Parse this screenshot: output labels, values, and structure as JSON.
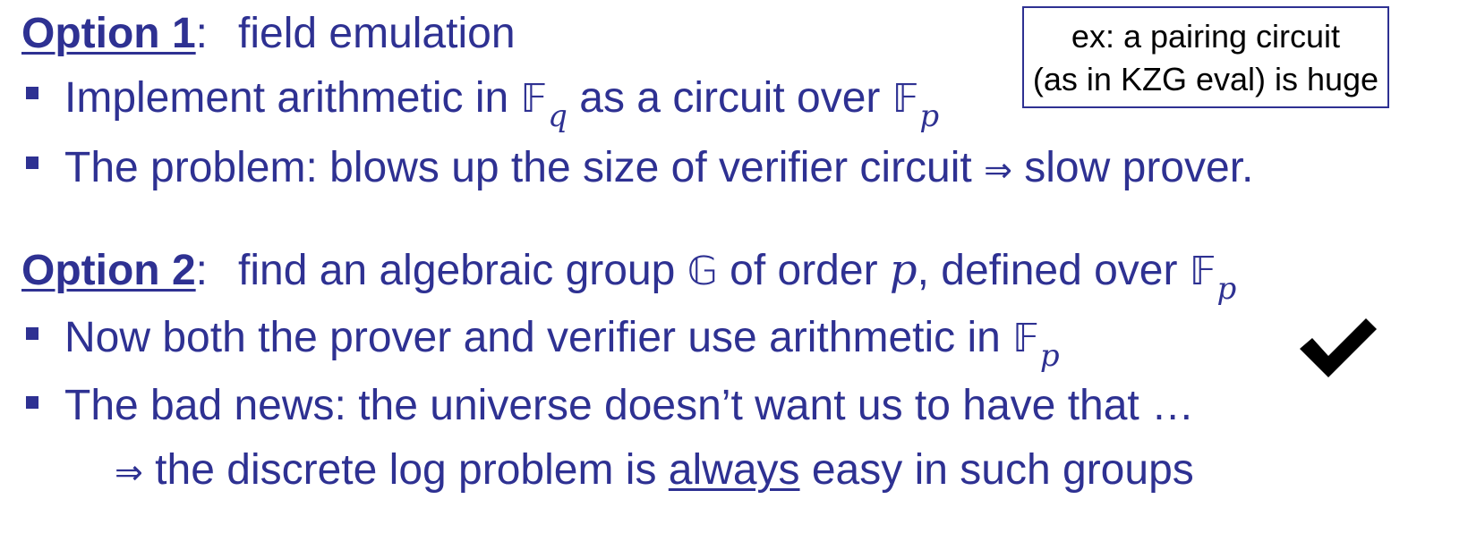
{
  "option1": {
    "label": "Option 1",
    "colon": ":",
    "title": "field emulation",
    "bullet1": {
      "text_before": "Implement arithmetic in ",
      "field_symbol": "𝔽",
      "field_sub": "q",
      "text_middle": " as a circuit over ",
      "field2_symbol": "𝔽",
      "field2_sub": "p"
    },
    "bullet2": {
      "text_before": "The problem:  blows up the size of verifier circuit  ",
      "arrow": "⇒",
      "text_after": "   slow prover."
    }
  },
  "note": {
    "line1": "ex: a pairing circuit",
    "line2": "(as in KZG eval) is huge"
  },
  "option2": {
    "label": "Option 2",
    "colon": ":",
    "title_before": "find an algebraic group ",
    "group_symbol": "𝔾",
    "title_middle": " of order ",
    "order_var": "p",
    "title_after": ", defined over ",
    "field_symbol": "𝔽",
    "field_sub": "p",
    "bullet1": {
      "text_before": "Now both the prover and verifier use arithmetic in ",
      "field_symbol": "𝔽",
      "field_sub": "p"
    },
    "bullet2": {
      "text": "The bad news:  the universe doesn’t want us to have that …"
    },
    "subline": {
      "arrow": "⇒",
      "text_before": "  the discrete log problem is ",
      "emphasis": "always",
      "text_after": " easy in such groups"
    }
  },
  "colors": {
    "text": "#2E3192",
    "note_text": "#000000",
    "checkmark": "#000000"
  },
  "icons": {
    "bullet": "square-bullet-icon",
    "check": "checkmark-icon"
  }
}
